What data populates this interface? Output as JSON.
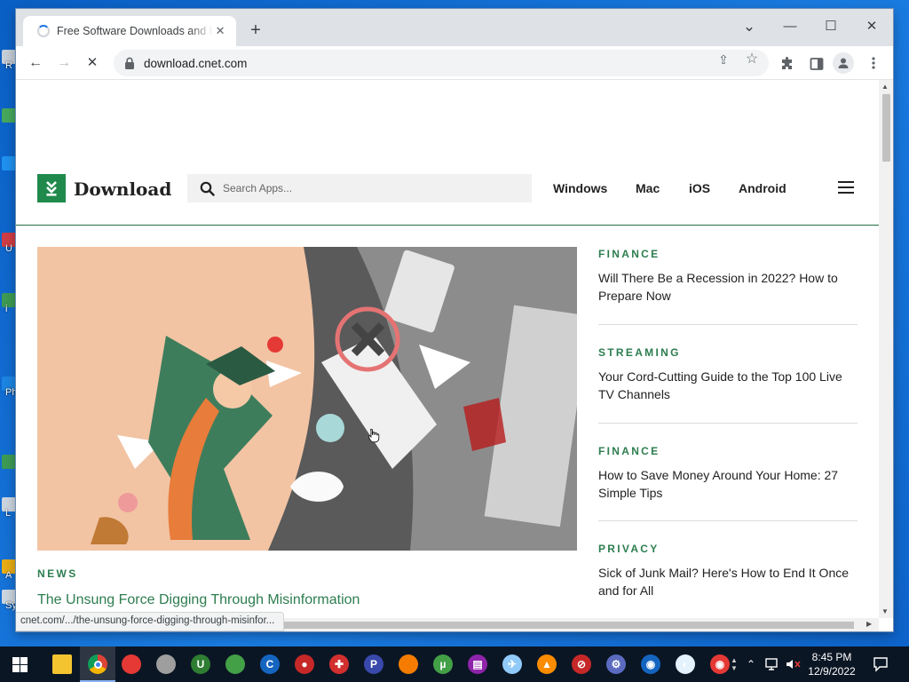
{
  "desktop": {
    "icons": [
      {
        "label": "R",
        "color": "#d9d9d9"
      },
      {
        "label": "",
        "color": "#4caf50"
      },
      {
        "label": "",
        "color": "#2196f3"
      },
      {
        "label": "U",
        "color": "#e53935"
      },
      {
        "label": "i",
        "color": "#43a047"
      },
      {
        "label": "Ph",
        "color": "#1e88e5"
      },
      {
        "label": "",
        "color": "#43a047"
      },
      {
        "label": "L",
        "color": "#e0e0e0"
      },
      {
        "label": "A",
        "color": "#ffb300"
      },
      {
        "label": "Sy",
        "color": "#e0e0e0"
      }
    ]
  },
  "browser": {
    "tab": {
      "title": "Free Software Downloads and Reviews",
      "close_glyph": "✕"
    },
    "new_tab_glyph": "+",
    "window_controls": {
      "tab_search": "⌄",
      "minimize": "—",
      "maximize": "☐",
      "close": "✕"
    },
    "toolbar": {
      "back": "←",
      "forward": "→",
      "stop": "✕"
    },
    "omnibox": {
      "url": "download.cnet.com"
    },
    "omnibox_icons": {
      "share": "⇪",
      "bookmark": "☆"
    },
    "status_url": "cnet.com/.../the-unsung-force-digging-through-misinfor..."
  },
  "site": {
    "logo_text": "Download",
    "search_placeholder": "Search Apps...",
    "nav": [
      "Windows",
      "Mac",
      "iOS",
      "Android"
    ],
    "hero": {
      "category": "NEWS",
      "title": "The Unsung Force Digging Through Misinformation"
    },
    "side_articles": [
      {
        "category": "FINANCE",
        "title": "Will There Be a Recession in 2022? How to Prepare Now"
      },
      {
        "category": "STREAMING",
        "title": "Your Cord-Cutting Guide to the Top 100 Live TV Channels"
      },
      {
        "category": "FINANCE",
        "title": "How to Save Money Around Your Home: 27 Simple Tips"
      },
      {
        "category": "PRIVACY",
        "title": "Sick of Junk Mail? Here's How to End It Once and for All"
      }
    ]
  },
  "taskbar": {
    "apps": [
      {
        "name": "file-explorer-icon",
        "glyph": "",
        "color": "#f4c430"
      },
      {
        "name": "chrome-icon",
        "glyph": "",
        "color": "#db4437"
      },
      {
        "name": "ccleaner-icon",
        "glyph": "",
        "color": "#e53935"
      },
      {
        "name": "app-icon-ring",
        "glyph": "",
        "color": "#9e9e9e"
      },
      {
        "name": "uplay-icon",
        "glyph": "U",
        "color": "#2e7d32"
      },
      {
        "name": "edge-icon",
        "glyph": "",
        "color": "#43a047"
      },
      {
        "name": "ccleaner-c-icon",
        "glyph": "C",
        "color": "#1565c0"
      },
      {
        "name": "screen-recorder-icon",
        "glyph": "●",
        "color": "#c62828"
      },
      {
        "name": "video-editor-icon",
        "glyph": "✚",
        "color": "#d32f2f"
      },
      {
        "name": "p-app-icon",
        "glyph": "P",
        "color": "#3949ab"
      },
      {
        "name": "avast-icon",
        "glyph": "",
        "color": "#f57c00"
      },
      {
        "name": "utorrent-icon",
        "glyph": "µ",
        "color": "#43a047"
      },
      {
        "name": "winrar-icon",
        "glyph": "▤",
        "color": "#8e24aa"
      },
      {
        "name": "sync-icon",
        "glyph": "✈",
        "color": "#90caf9"
      },
      {
        "name": "vlc-icon",
        "glyph": "▲",
        "color": "#fb8c00"
      },
      {
        "name": "snagit-icon",
        "glyph": "⊘",
        "color": "#c62828"
      },
      {
        "name": "settings-app-icon",
        "glyph": "⚙",
        "color": "#5c6bc0"
      },
      {
        "name": "bitdefender-icon",
        "glyph": "◉",
        "color": "#1565c0"
      },
      {
        "name": "cleaner-app-icon",
        "glyph": "◐",
        "color": "#e3f2fd"
      },
      {
        "name": "record-app-icon",
        "glyph": "◉",
        "color": "#e53935"
      }
    ],
    "clock": {
      "time": "8:45 PM",
      "date": "12/9/2022"
    }
  }
}
